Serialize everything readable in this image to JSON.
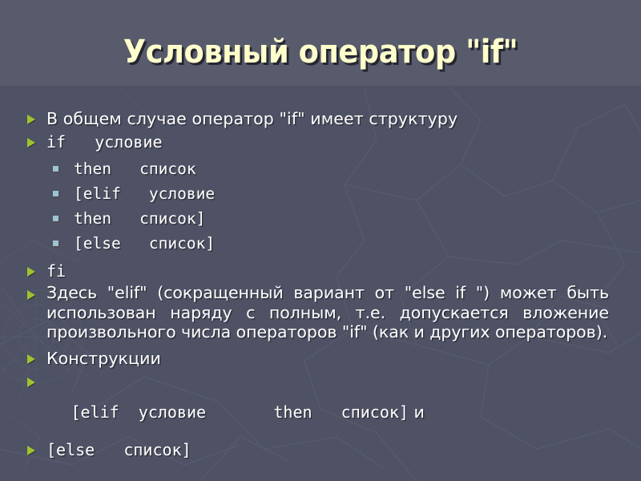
{
  "slide": {
    "title": "Условный оператор \"if\"",
    "background_color": "#4e5264",
    "title_color": "#ffffcc",
    "text_color": "#ffffff",
    "bullet_triangle_color": "#9fc32e",
    "bullet_square_color": "#9cc4d4",
    "content": [
      {
        "level": 1,
        "style": "sans",
        "text": "В общем случае оператор \"if\" имеет структуру"
      },
      {
        "level": 1,
        "style": "mono",
        "text": "if   условие"
      },
      {
        "level": 2,
        "style": "mono",
        "text": "then   список"
      },
      {
        "level": 2,
        "style": "mono",
        "text": "[elif   условие"
      },
      {
        "level": 2,
        "style": "mono",
        "text": "then   список]"
      },
      {
        "level": 2,
        "style": "mono",
        "text": "[else   список]"
      },
      {
        "level": 1,
        "style": "mono",
        "text": "fi"
      },
      {
        "level": 1,
        "style": "para",
        "text": "Здесь \"elif\" (сокращенный вариант от \"else if \") может быть использован наряду с полным, т.е. допускается вложение произвольного числа операторов \"if\" (как и других операторов)."
      },
      {
        "level": 1,
        "style": "sans",
        "text": "Конструкции"
      },
      {
        "level": 1,
        "style": "mixed",
        "text": "[elif  условие       then   список]",
        "tail": " и"
      },
      {
        "level": 1,
        "style": "mono",
        "text": "[else   список]"
      }
    ]
  }
}
